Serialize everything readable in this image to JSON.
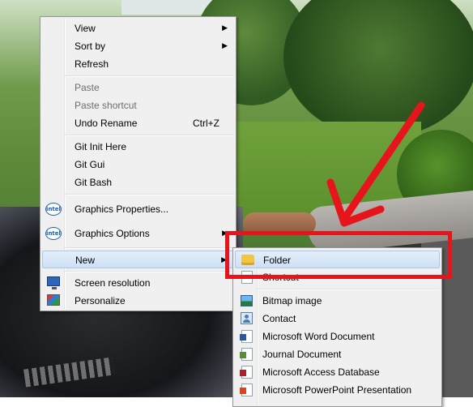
{
  "main_menu": {
    "items": [
      {
        "label": "View",
        "submenu": true
      },
      {
        "label": "Sort by",
        "submenu": true
      },
      {
        "label": "Refresh"
      },
      {
        "label": "Paste",
        "disabled": true
      },
      {
        "label": "Paste shortcut",
        "disabled": true
      },
      {
        "label": "Undo Rename",
        "accel": "Ctrl+Z"
      },
      {
        "label": "Git Init Here"
      },
      {
        "label": "Git Gui"
      },
      {
        "label": "Git Bash"
      },
      {
        "label": "Graphics Properties...",
        "icon": "intel-icon"
      },
      {
        "label": "Graphics Options",
        "icon": "intel-icon",
        "submenu": true
      },
      {
        "label": "New",
        "submenu": true,
        "highlighted": true
      },
      {
        "label": "Screen resolution",
        "icon": "screen-resolution-icon"
      },
      {
        "label": "Personalize",
        "icon": "personalize-icon"
      }
    ]
  },
  "new_submenu": {
    "items": [
      {
        "label": "Folder",
        "icon": "folder-icon",
        "highlighted": true
      },
      {
        "label": "Shortcut",
        "icon": "shortcut-icon"
      },
      {
        "label": "Bitmap image",
        "icon": "bitmap-image-icon"
      },
      {
        "label": "Contact",
        "icon": "contact-icon"
      },
      {
        "label": "Microsoft Word Document",
        "icon": "word-document-icon"
      },
      {
        "label": "Journal Document",
        "icon": "journal-document-icon"
      },
      {
        "label": "Microsoft Access Database",
        "icon": "access-database-icon"
      },
      {
        "label": "Microsoft PowerPoint Presentation",
        "icon": "powerpoint-presentation-icon"
      }
    ]
  },
  "intel_logo_text": "intel",
  "colors": {
    "annotation": "#e6151b",
    "menu_background": "#f0f0f0",
    "highlight": "#cfe0f5"
  }
}
